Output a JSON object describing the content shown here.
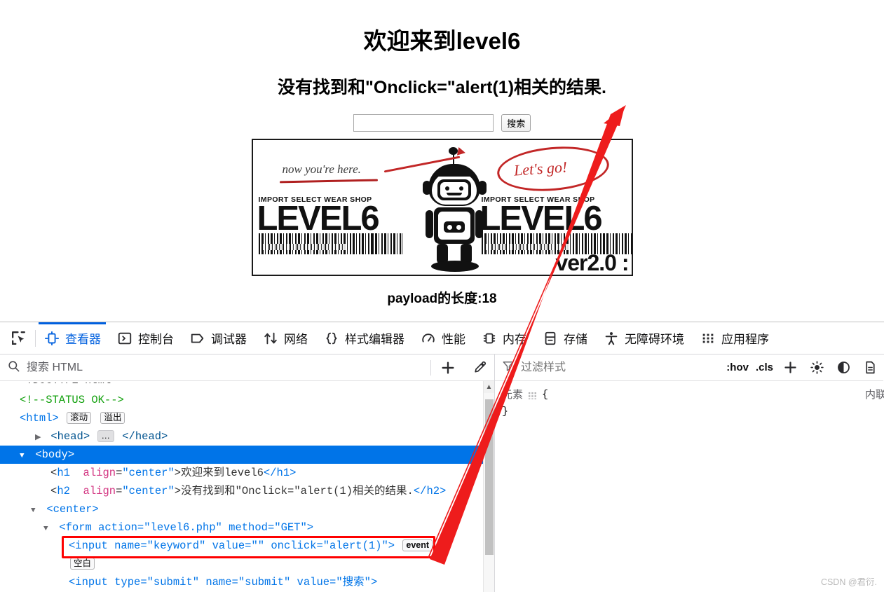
{
  "page": {
    "h1": "欢迎来到level6",
    "h2": "没有找到和\"Onclick=\"alert(1)相关的结果.",
    "search_value": "",
    "search_placeholder": "",
    "submit_label": "搜索",
    "payload_text": "payload的长度:18",
    "banner": {
      "hand_note": "now you're here.",
      "shop_text_left": "IMPORT SELECT WEAR SHOP",
      "level_left": "LEVEL6",
      "shop_text_right": "IMPORT SELECT WEAR SHOP",
      "level_right": "LEVEL6",
      "lets_go": "Let's go!",
      "version": "ver2.0 :"
    }
  },
  "devtools": {
    "picker_icon": "element-picker-icon",
    "tabs": [
      {
        "label": "查看器",
        "icon": "inspector-icon",
        "active": true
      },
      {
        "label": "控制台",
        "icon": "console-icon",
        "active": false
      },
      {
        "label": "调试器",
        "icon": "debugger-icon",
        "active": false
      },
      {
        "label": "网络",
        "icon": "network-icon",
        "active": false
      },
      {
        "label": "样式编辑器",
        "icon": "style-editor-icon",
        "active": false
      },
      {
        "label": "性能",
        "icon": "performance-icon",
        "active": false
      },
      {
        "label": "内存",
        "icon": "memory-icon",
        "active": false
      },
      {
        "label": "存储",
        "icon": "storage-icon",
        "active": false
      },
      {
        "label": "无障碍环境",
        "icon": "accessibility-icon",
        "active": false
      },
      {
        "label": "应用程序",
        "icon": "application-icon",
        "active": false
      }
    ],
    "inspector": {
      "search_placeholder": "搜索 HTML",
      "search_value": "",
      "add_node_label": "+",
      "eyedropper_icon": "eyedropper-icon",
      "markup": [
        {
          "indent": 1,
          "type": "comment",
          "text": "<!--STATUS OK-->"
        },
        {
          "indent": 1,
          "type": "html_tag",
          "text": "<html>",
          "badges": [
            "滚动",
            "溢出"
          ]
        },
        {
          "indent": 1,
          "type": "collapsed",
          "text": "<head>",
          "close": "</head>",
          "twisty": "▶",
          "badges": [
            "…"
          ]
        },
        {
          "indent": 1,
          "type": "open",
          "text": "<body>",
          "twisty": "▼",
          "selected": true
        },
        {
          "indent": 2,
          "type": "element_attr",
          "tag": "h1",
          "attr": "align",
          "attr_value": "\"center\"",
          "content": "欢迎来到level6",
          "close": "</h1>"
        },
        {
          "indent": 2,
          "type": "element_attr",
          "tag": "h2",
          "attr": "align",
          "attr_value": "\"center\"",
          "content": "没有找到和\"Onclick=\"alert(1)相关的结果.",
          "close": "</h2>"
        },
        {
          "indent": 2,
          "type": "open",
          "text": "<center>",
          "twisty": "▼"
        },
        {
          "indent": 3,
          "type": "form",
          "text": "<form action=\"level6.php\" method=\"GET\">",
          "twisty": "▼"
        },
        {
          "indent": 4,
          "type": "input_highlighted",
          "text": "<input name=\"keyword\" value=\"\" onclick=\"alert(1)\">",
          "badges": [
            "event"
          ]
        },
        {
          "indent": 4,
          "type": "badge_only",
          "badges": [
            "空白"
          ]
        },
        {
          "indent": 4,
          "type": "input_submit",
          "text": "<input type=\"submit\" name=\"submit\" value=\"搜索\">"
        }
      ]
    },
    "rules": {
      "filter_placeholder": "过滤样式",
      "filter_value": "",
      "hov_label": ":hov",
      "cls_label": ".cls",
      "add_rule_label": "+",
      "light_icon": "sun-icon",
      "contrast_icon": "contrast-icon",
      "print_icon": "document-icon",
      "element_rule_selector": "元素",
      "element_rule_open": "{",
      "element_rule_close": "}",
      "element_rule_source": "内联"
    }
  },
  "annotation": {
    "arrow_color": "#ee1c1c",
    "highlight_box_color": "#fe0000"
  },
  "watermark": "CSDN @君衍."
}
